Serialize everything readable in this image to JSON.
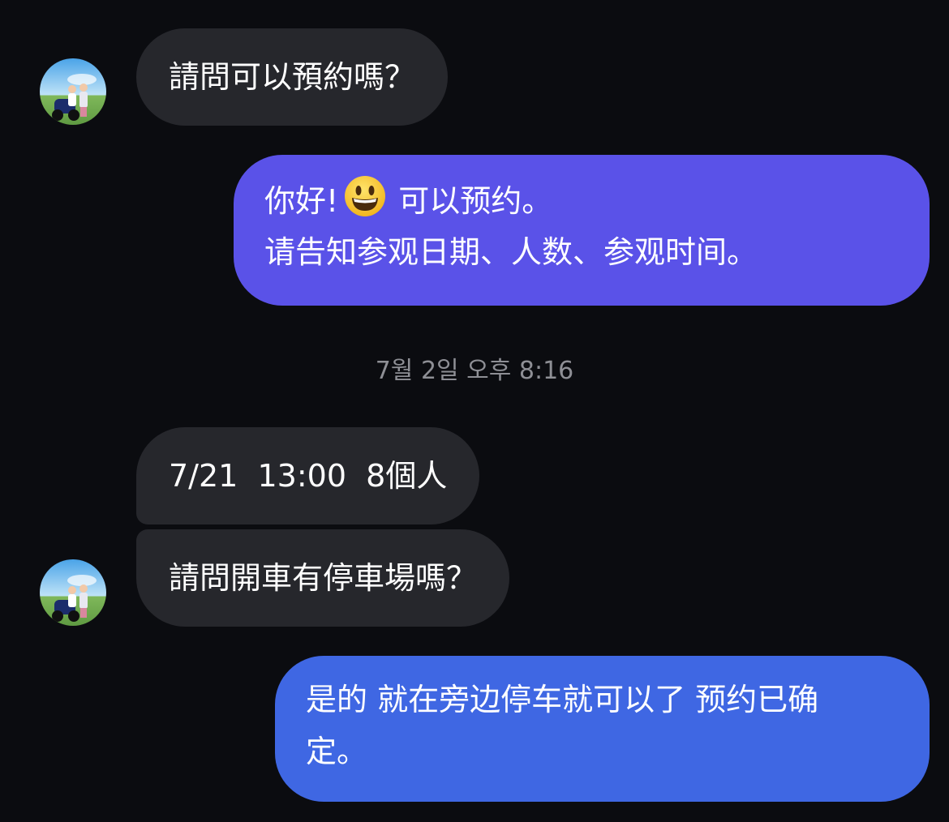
{
  "messages": {
    "m1": {
      "text": "請問可以預約嗎？"
    },
    "m2": {
      "line1": "你好!",
      "emoji": "grinning-face",
      "line1_rest": "可以预约。",
      "line2": "请告知参观日期、人数、参观时间。"
    },
    "timestamp": "7월 2일 오후 8:16",
    "m3": {
      "text": "7/21  13:00  8個人"
    },
    "m4": {
      "text": "請問開車有停車場嗎？"
    },
    "m5": {
      "line1": "是的 就在旁边停车就可以了 预约已确",
      "line2": "定。"
    }
  },
  "colors": {
    "background": "#0b0c10",
    "incoming_bubble": "#26272c",
    "outgoing_top": "#5a52e8",
    "outgoing_bottom": "#3f67e3",
    "timestamp": "#8e8f95"
  }
}
